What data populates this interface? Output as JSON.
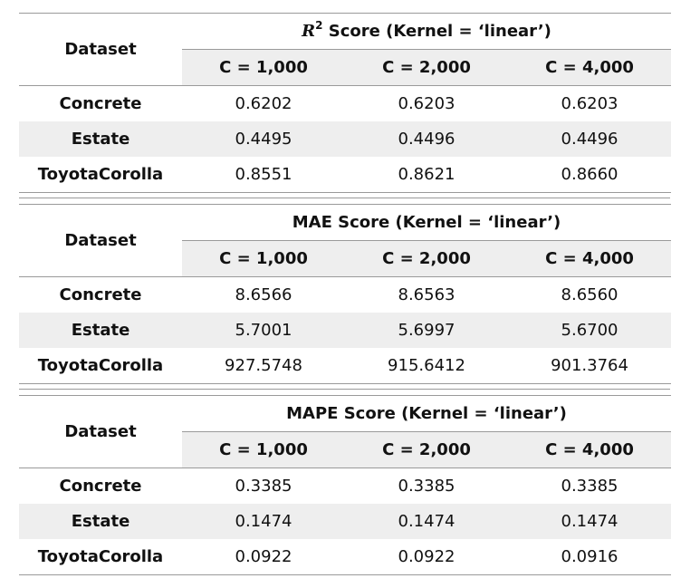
{
  "tables": [
    {
      "metric_prefix": "R",
      "metric_sup": "2",
      "metric_rest": " Score (Kernel = ‘linear’)",
      "dataset_header": "Dataset",
      "columns": [
        "C = 1,000",
        "C = 2,000",
        "C = 4,000"
      ],
      "rows": [
        {
          "name": "Concrete",
          "values": [
            "0.6202",
            "0.6203",
            "0.6203"
          ]
        },
        {
          "name": "Estate",
          "values": [
            "0.4495",
            "0.4496",
            "0.4496"
          ]
        },
        {
          "name": "ToyotaCorolla",
          "values": [
            "0.8551",
            "0.8621",
            "0.8660"
          ]
        }
      ]
    },
    {
      "metric": "MAE Score (Kernel = ‘linear’)",
      "dataset_header": "Dataset",
      "columns": [
        "C = 1,000",
        "C = 2,000",
        "C = 4,000"
      ],
      "rows": [
        {
          "name": "Concrete",
          "values": [
            "8.6566",
            "8.6563",
            "8.6560"
          ]
        },
        {
          "name": "Estate",
          "values": [
            "5.7001",
            "5.6997",
            "5.6700"
          ]
        },
        {
          "name": "ToyotaCorolla",
          "values": [
            "927.5748",
            "915.6412",
            "901.3764"
          ]
        }
      ]
    },
    {
      "metric": "MAPE Score (Kernel = ‘linear’)",
      "dataset_header": "Dataset",
      "columns": [
        "C = 1,000",
        "C = 2,000",
        "C = 4,000"
      ],
      "rows": [
        {
          "name": "Concrete",
          "values": [
            "0.3385",
            "0.3385",
            "0.3385"
          ]
        },
        {
          "name": "Estate",
          "values": [
            "0.1474",
            "0.1474",
            "0.1474"
          ]
        },
        {
          "name": "ToyotaCorolla",
          "values": [
            "0.0922",
            "0.0922",
            "0.0916"
          ]
        }
      ]
    }
  ]
}
